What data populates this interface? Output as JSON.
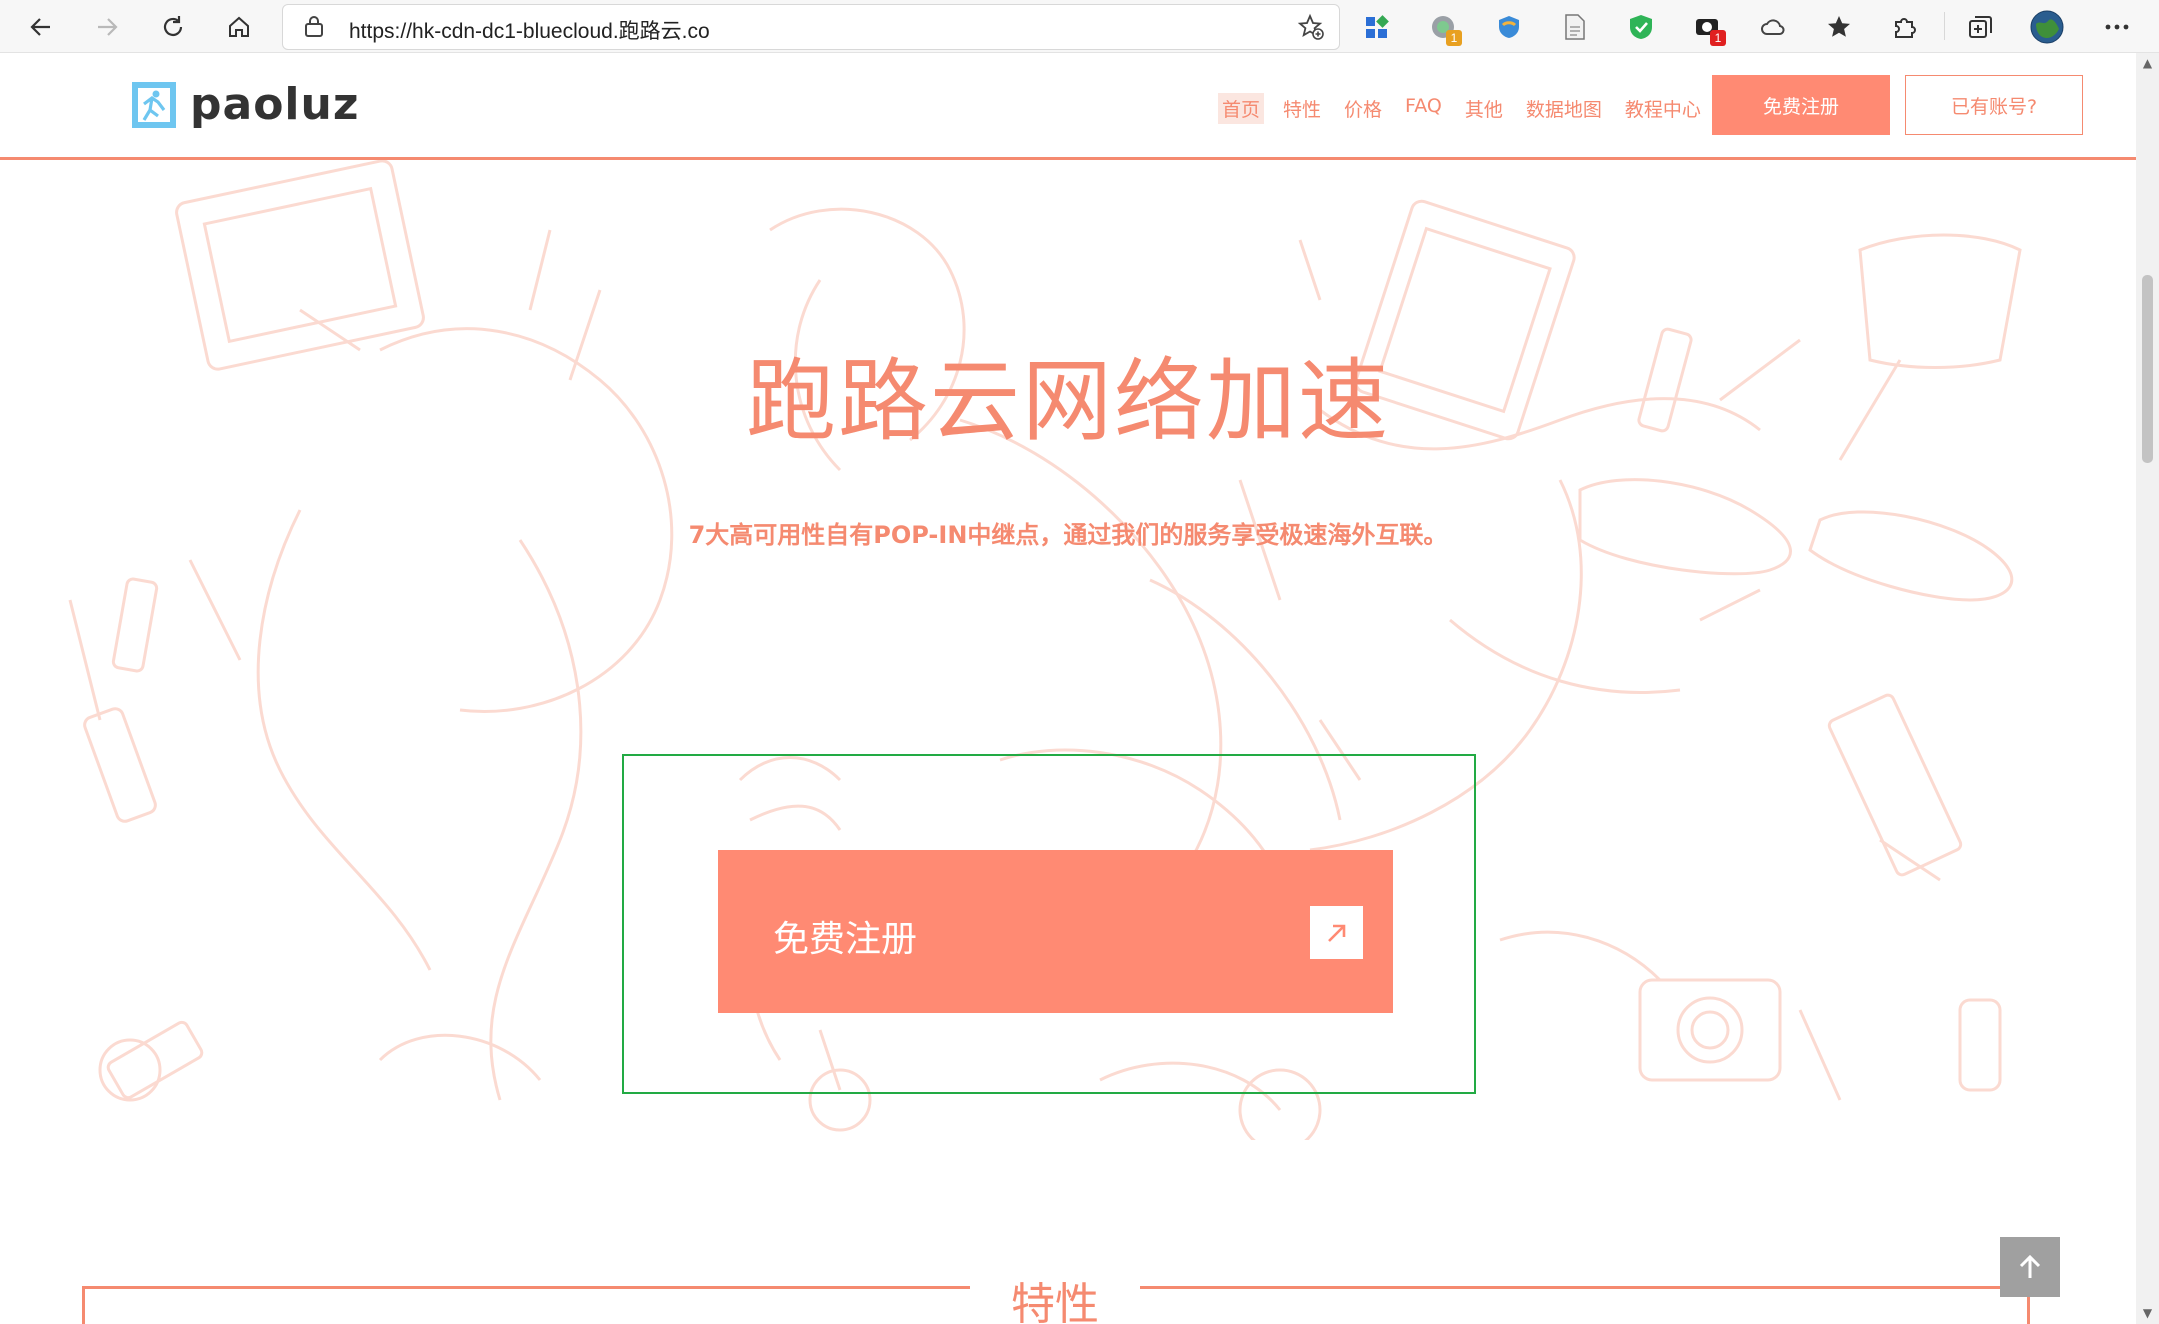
{
  "browser": {
    "url": "https://hk-cdn-dc1-bluecloud.跑路云.co",
    "icons": [
      "back-icon",
      "forward-icon",
      "refresh-icon",
      "home-icon",
      "lock-icon",
      "favorite-add-icon"
    ],
    "extensions": [
      {
        "name": "apps-grid-icon"
      },
      {
        "name": "extension-green-icon",
        "badge": "1",
        "badge_color": "#e8a020"
      },
      {
        "name": "extension-shield-blue-icon"
      },
      {
        "name": "document-icon"
      },
      {
        "name": "shield-check-icon"
      },
      {
        "name": "extension-camera-icon",
        "badge": "1",
        "badge_color": "#e02020"
      },
      {
        "name": "cloud-icon"
      },
      {
        "name": "favorites-star-icon"
      },
      {
        "name": "extensions-puzzle-icon"
      },
      {
        "name": "collections-icon"
      },
      {
        "name": "profile-avatar-icon"
      },
      {
        "name": "more-menu-icon"
      }
    ]
  },
  "header": {
    "logo_text": "paoluz",
    "menu": [
      "首页",
      "特性",
      "价格",
      "FAQ",
      "其他",
      "数据地图",
      "教程中心"
    ],
    "register_label": "免费注册",
    "login_label": "已有账号?"
  },
  "hero": {
    "title": "跑路云网络加速",
    "subtitle": "7大高可用性自有POP-IN中继点，通过我们的服务享受极速海外互联。",
    "cta_label": "免费注册"
  },
  "features": {
    "title": "特性"
  },
  "colors": {
    "accent": "#ff8a73",
    "accent_text": "#f58a70",
    "highlight_border": "#22aa44"
  }
}
